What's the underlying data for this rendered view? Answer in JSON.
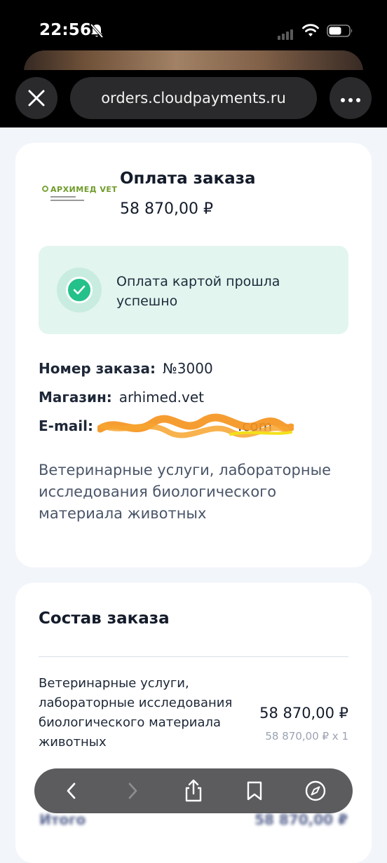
{
  "status_bar": {
    "time": "22:56"
  },
  "browser": {
    "url": "orders.cloudpayments.ru"
  },
  "merchant": {
    "logo_text": "АРХИМЕД VET"
  },
  "payment": {
    "title": "Оплата заказа",
    "amount": "58 870,00 ₽",
    "success_message": "Оплата картой прошла успешно",
    "order_number_label": "Номер заказа:",
    "order_number": "№3000",
    "shop_label": "Магазин:",
    "shop": "arhimed.vet",
    "email_label": "E-mail:",
    "email_visible": ".com",
    "description": "Ветеринарные услуги, лабораторные исследования биологического материала животных"
  },
  "order": {
    "title": "Состав заказа",
    "items": [
      {
        "name": "Ветеринарные услуги, лабораторные исследования биологического материала животных",
        "price": "58 870,00 ₽",
        "unit_price_qty": "58 870,00 ₽ x 1"
      }
    ],
    "total_label": "Итого",
    "total_value": "58 870,00 ₽"
  },
  "colors": {
    "accent_success": "#24c18a",
    "success_bg": "#e2f5ef",
    "page_bg": "#f2f5fa",
    "chrome": "#000000"
  }
}
